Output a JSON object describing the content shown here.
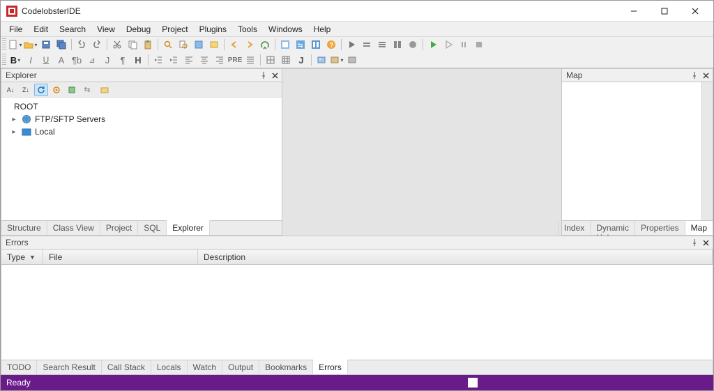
{
  "app": {
    "title": "CodelobsterIDE"
  },
  "win_btns": {
    "min": "—",
    "max": "☐",
    "close": "✕"
  },
  "menu": [
    "File",
    "Edit",
    "Search",
    "View",
    "Debug",
    "Project",
    "Plugins",
    "Tools",
    "Windows",
    "Help"
  ],
  "toolbar_row1_names": [
    "new",
    "new-dd",
    "open",
    "open-dd",
    "save",
    "save-all",
    "undo",
    "redo",
    "cut",
    "copy",
    "paste",
    "find",
    "find-in-files",
    "toggle-bm",
    "replace",
    "nav-back",
    "nav-fwd",
    "help-context",
    "reload",
    "highlight1",
    "highlight2",
    "help",
    "run",
    "step-over",
    "step-into",
    "step-out",
    "breakpoint",
    "continue",
    "play",
    "pause",
    "stop",
    "settings"
  ],
  "toolbar_row2_names": [
    "bold",
    "bold-dd",
    "italic",
    "underline",
    "font",
    "pilcrow",
    "bullet",
    "J",
    "pilcrow2",
    "H",
    "outdent",
    "indent",
    "align-left",
    "align-center",
    "align-right",
    "numbered",
    "pre",
    "align-just",
    "grid",
    "unknown",
    "J2",
    "image",
    "insert-table",
    "object"
  ],
  "explorer": {
    "title": "Explorer",
    "toolbar_names": [
      "sort-az",
      "sort-za",
      "refresh",
      "settings",
      "collapse",
      "sync",
      "show-all"
    ],
    "tree": {
      "root": "ROOT",
      "items": [
        {
          "label": "FTP/SFTP Servers",
          "icon": "globe"
        },
        {
          "label": "Local",
          "icon": "folder"
        }
      ]
    },
    "tabs": [
      "Structure",
      "Class View",
      "Project",
      "SQL",
      "Explorer"
    ],
    "active_tab": 4
  },
  "map": {
    "title": "Map",
    "tabs": [
      "Index",
      "Dynamic Help",
      "Properties",
      "Map"
    ],
    "active_tab": 3
  },
  "bottom": {
    "title": "Errors",
    "columns": [
      "Type",
      "File",
      "Description"
    ],
    "tabs": [
      "TODO",
      "Search Result",
      "Call Stack",
      "Locals",
      "Watch",
      "Output",
      "Bookmarks",
      "Errors"
    ],
    "active_tab": 7
  },
  "status": {
    "text": "Ready"
  },
  "colors": {
    "status_bg": "#6a1b8a",
    "status_fg": "#ffffff",
    "accent": "#cde6f7"
  }
}
